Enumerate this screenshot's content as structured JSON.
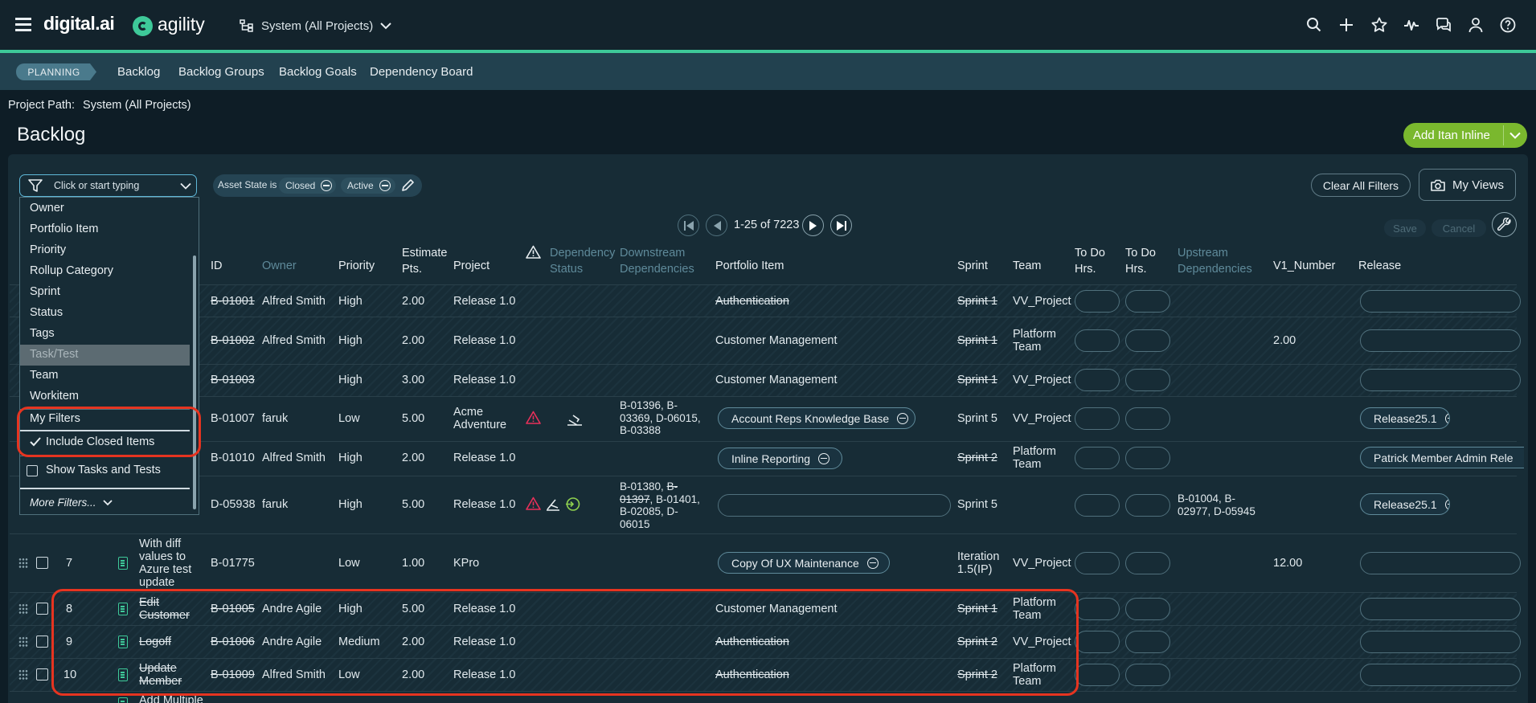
{
  "brand": {
    "digital": "digital.ai",
    "product": "agility"
  },
  "header": {
    "project_selector": "System (All Projects)"
  },
  "icons": {
    "menu": "hamburger-icon",
    "search": "search-icon",
    "add": "plus-icon",
    "favorite": "star-icon",
    "activity": "pulse-icon",
    "chat": "chat-icon",
    "user": "user-icon",
    "help": "help-icon"
  },
  "subnav": {
    "section": "PLANNING",
    "items": [
      "Backlog",
      "Backlog Groups",
      "Backlog Goals",
      "Dependency Board"
    ]
  },
  "project_path": {
    "label": "Project Path:",
    "value": "System (All Projects)"
  },
  "page": {
    "title": "Backlog",
    "add_button": "Add Itan Inline"
  },
  "filter": {
    "placeholder": "Click or start typing",
    "asset_state_label": "Asset State is",
    "state_closed": "Closed",
    "state_active": "Active",
    "clear_all": "Clear All Filters",
    "my_views": "My Views"
  },
  "pager": {
    "text": "1-25 of 7223",
    "save": "Save",
    "cancel": "Cancel"
  },
  "dropdown": {
    "items": [
      "Owner",
      "Portfolio Item",
      "Priority",
      "Rollup Category",
      "Sprint",
      "Status",
      "Tags",
      "Task/Test",
      "Team",
      "Workitem"
    ],
    "highlighted": "Task/Test",
    "my_filters": "My Filters",
    "include_closed": "Include Closed Items",
    "show_tasks": "Show Tasks and Tests",
    "more_filters": "More Filters..."
  },
  "columns": {
    "id": "ID",
    "owner": "Owner",
    "priority": "Priority",
    "estimate_1": "Estimate",
    "estimate_2": "Pts.",
    "project": "Project",
    "dep_status_1": "Dependency",
    "dep_status_2": "Status",
    "downstream_1": "Downstream",
    "downstream_2": "Dependencies",
    "portfolio": "Portfolio Item",
    "sprint": "Sprint",
    "team": "Team",
    "todo1_1": "To Do",
    "todo1_2": "Hrs.",
    "todo2_1": "To Do",
    "todo2_2": "Hrs.",
    "upstream_1": "Upstream",
    "upstream_2": "Dependencies",
    "v1": "V1_Number",
    "release": "Release"
  },
  "rows": [
    {
      "num": "",
      "title": "",
      "id": "B-01001",
      "owner": "Alfred Smith",
      "priority": "High",
      "estimate": "2.00",
      "project": "Release 1.0",
      "downstream": "",
      "portfolio": "Authentication",
      "sprint": "Sprint 1",
      "team": "VV_Project",
      "upstream": "",
      "v1": "",
      "release": ""
    },
    {
      "num": "",
      "title": "",
      "id": "B-01002",
      "owner": "Alfred Smith",
      "priority": "High",
      "estimate": "2.00",
      "project": "Release 1.0",
      "downstream": "",
      "portfolio": "Customer Management",
      "sprint": "Sprint 1",
      "team": "Platform Team",
      "upstream": "",
      "v1": "2.00",
      "release": ""
    },
    {
      "num": "",
      "title": "",
      "id": "B-01003",
      "owner": "",
      "priority": "High",
      "estimate": "3.00",
      "project": "Release 1.0",
      "downstream": "",
      "portfolio": "Customer Management",
      "sprint": "Sprint 1",
      "team": "VV_Project",
      "upstream": "",
      "v1": "",
      "release": ""
    },
    {
      "num": "",
      "title": "",
      "id": "B-01007",
      "owner": "faruk",
      "priority": "Low",
      "estimate": "5.00",
      "project": "Acme Adventure",
      "downstream": "B-01396, B-03369, D-06015, B-03388",
      "portfolio": "Account Reps Knowledge Base",
      "sprint": "Sprint 5",
      "team": "VV_Project",
      "upstream": "",
      "v1": "",
      "release": "Release25.1"
    },
    {
      "num": "",
      "title": "",
      "id": "B-01010",
      "owner": "Alfred Smith",
      "priority": "High",
      "estimate": "2.00",
      "project": "Release 1.0",
      "downstream": "",
      "portfolio": "Inline Reporting",
      "sprint": "Sprint 2",
      "team": "Platform Team",
      "upstream": "",
      "v1": "",
      "release": "Patrick Member Admin Rele"
    },
    {
      "num": "",
      "title": "",
      "id": "D-05938",
      "owner": "faruk",
      "priority": "High",
      "estimate": "5.00",
      "project": "Release 1.0",
      "downstream_a": "B-01380,",
      "downstream_b": "B-",
      "downstream_c": "01397",
      "downstream_d": ", B-01401,",
      "downstream_e": "B-02085, D-",
      "downstream_f": "06015",
      "portfolio": "",
      "sprint": "Sprint 5",
      "team": "",
      "upstream": "B-01004, B-02977, D-05945",
      "v1": "",
      "release": "Release25.1"
    },
    {
      "num": "7",
      "title": "With diff values to Azure test update",
      "id": "B-01775",
      "owner": "",
      "priority": "Low",
      "estimate": "1.00",
      "project": "KPro",
      "downstream": "",
      "portfolio": "Copy Of UX Maintenance",
      "sprint": "Iteration 1.5(IP)",
      "team": "VV_Project",
      "upstream": "",
      "v1": "12.00",
      "release": ""
    },
    {
      "num": "8",
      "title": "Edit Customer",
      "id": "B-01005",
      "owner": "Andre Agile",
      "priority": "High",
      "estimate": "5.00",
      "project": "Release 1.0",
      "downstream": "",
      "portfolio": "Customer Management",
      "sprint": "Sprint 1",
      "team": "Platform Team",
      "upstream": "",
      "v1": "",
      "release": ""
    },
    {
      "num": "9",
      "title": "Logoff",
      "id": "B-01006",
      "owner": "Andre Agile",
      "priority": "Medium",
      "estimate": "2.00",
      "project": "Release 1.0",
      "downstream": "",
      "portfolio": "Authentication",
      "sprint": "Sprint 2",
      "team": "VV_Project",
      "upstream": "",
      "v1": "",
      "release": ""
    },
    {
      "num": "10",
      "title": "Update Member",
      "id": "B-01009",
      "owner": "Alfred Smith",
      "priority": "Low",
      "estimate": "2.00",
      "project": "Release 1.0",
      "downstream": "",
      "portfolio": "Authentication",
      "sprint": "Sprint 2",
      "team": "Platform Team",
      "upstream": "",
      "v1": "",
      "release": ""
    },
    {
      "num": "",
      "title": "Add Multiple",
      "id": "",
      "owner": "",
      "priority": "",
      "estimate": "",
      "project": "",
      "downstream": "",
      "portfolio": "",
      "sprint": "",
      "team": "",
      "upstream": "",
      "v1": "",
      "release": ""
    }
  ],
  "colors": {
    "accent": "#3ec999",
    "add_button": "#7ab82e",
    "highlight": "#e63420",
    "warning": "#e8305a"
  }
}
